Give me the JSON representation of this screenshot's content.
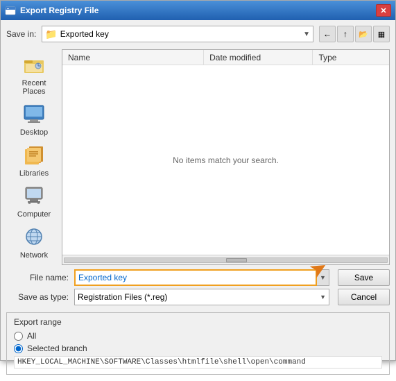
{
  "window": {
    "title": "Export Registry File",
    "close_label": "✕"
  },
  "save_in": {
    "label": "Save in:",
    "value": "Exported key"
  },
  "toolbar": {
    "back_label": "←",
    "up_label": "↑",
    "new_folder_label": "📁",
    "views_label": "▦"
  },
  "file_list": {
    "col_name": "Name",
    "col_date": "Date modified",
    "col_type": "Type",
    "empty_message": "No items match your search."
  },
  "sidebar": {
    "items": [
      {
        "id": "recent-places",
        "label": "Recent Places",
        "icon": "🕐"
      },
      {
        "id": "desktop",
        "label": "Desktop",
        "icon": "🖥"
      },
      {
        "id": "libraries",
        "label": "Libraries",
        "icon": "📚"
      },
      {
        "id": "computer",
        "label": "Computer",
        "icon": "💻"
      },
      {
        "id": "network",
        "label": "Network",
        "icon": "🌐"
      }
    ]
  },
  "fields": {
    "file_name_label": "File name:",
    "file_name_value": "Exported key",
    "save_as_label": "Save as type:",
    "save_as_value": "Registration Files (*.reg)"
  },
  "buttons": {
    "save_label": "Save",
    "cancel_label": "Cancel"
  },
  "export_range": {
    "title": "Export range",
    "all_label": "All",
    "selected_label": "Selected branch",
    "branch_value": "HKEY_LOCAL_MACHINE\\SOFTWARE\\Classes\\htmlfile\\shell\\open\\command"
  }
}
